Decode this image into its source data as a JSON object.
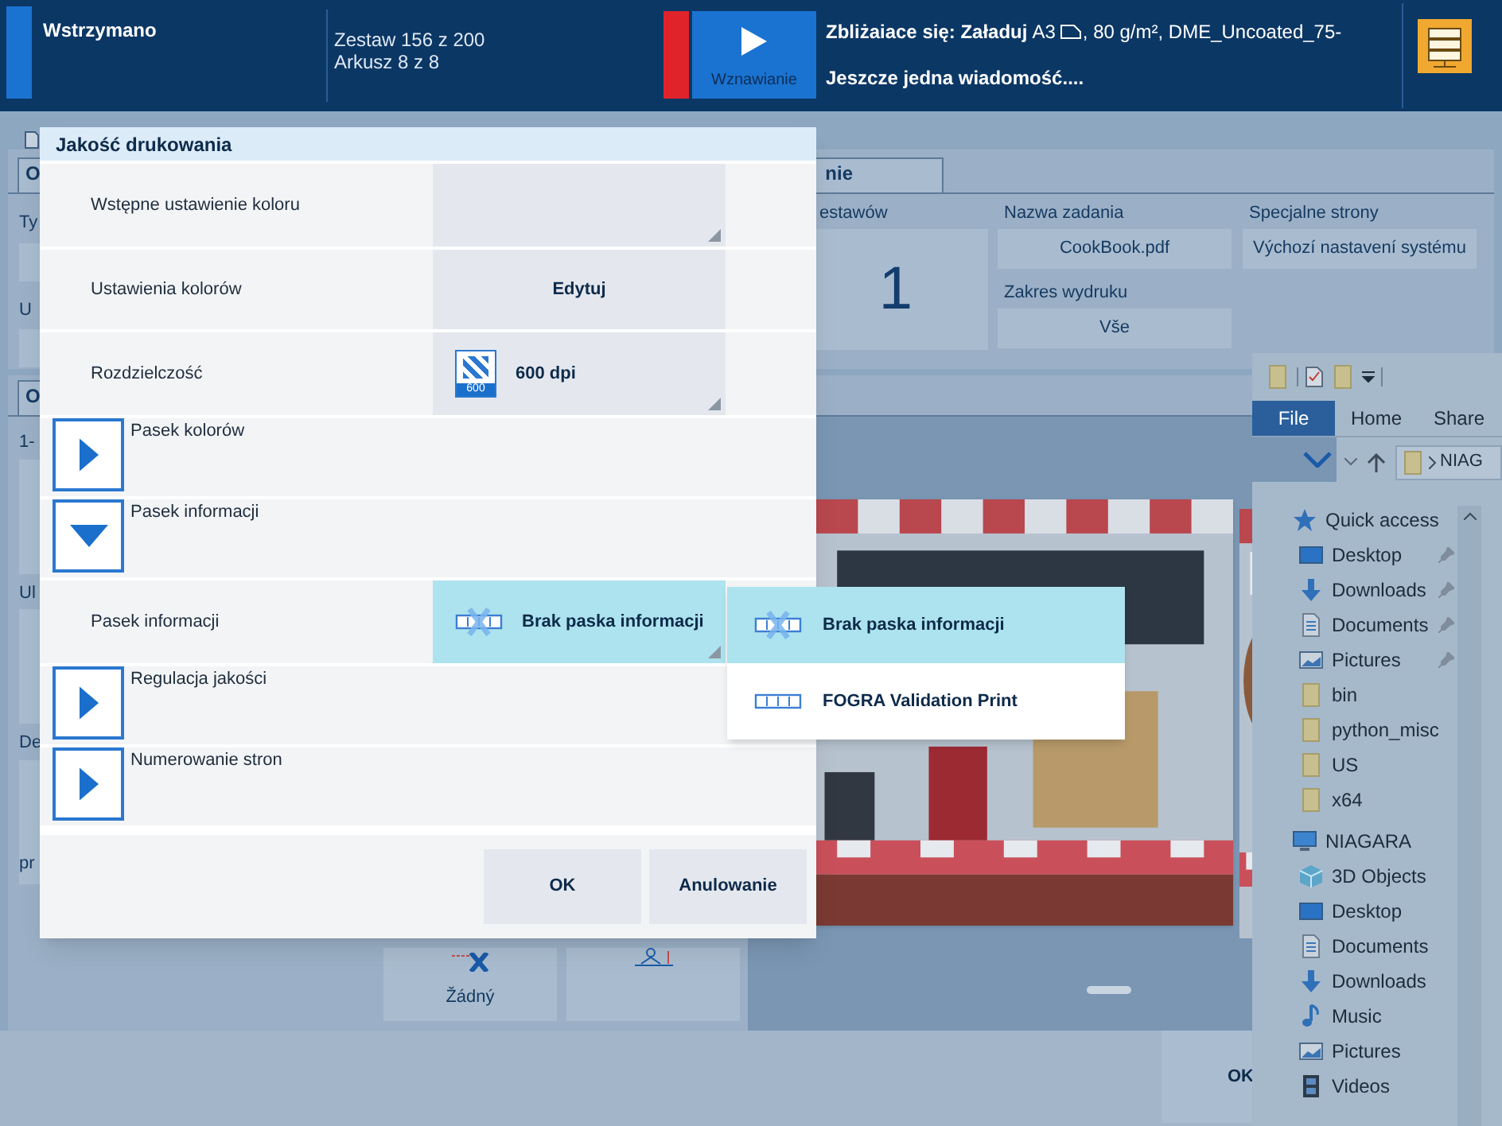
{
  "status_bar": {
    "state": "Wstrzymano",
    "set_progress": "Zestaw 156 z 200",
    "sheet_progress": "Arkusz 8 z 8",
    "resume_button": "Wznawianie",
    "upcoming_label": "Zbliżaiace się: Załaduj",
    "paper_size": "A3",
    "paper_details": ", 80 g/m², DME_Uncoated_75-",
    "message": "Jeszcze jedna wiadomość...."
  },
  "job_panel": {
    "left_tab": "O",
    "left_labels": [
      "Ty",
      "U"
    ],
    "right_tab": "nie",
    "sets_label": "estawów",
    "sets_value": "1",
    "fields": [
      {
        "label": "Nazwa zadania",
        "value": "CookBook.pdf"
      },
      {
        "label": "Zakres wydruku",
        "value": "Vše"
      },
      {
        "label": "Specjalne strony",
        "value": "Výchozí nastavení systému"
      }
    ]
  },
  "preview_panel": {
    "tab": "O",
    "labels": [
      "1-",
      "Ul",
      "De"
    ],
    "box_label": "pr",
    "tile_label": "Žádný"
  },
  "bottom_bar": {
    "ok_button": "OK"
  },
  "dialog": {
    "title": "Jakość drukowania",
    "rows": [
      {
        "kind": "select",
        "label": "Wstępne ustawienie koloru",
        "open": false
      },
      {
        "kind": "button",
        "label": "Ustawienia kolorów",
        "value": "Edytuj"
      },
      {
        "kind": "resolution",
        "label": "Rozdzielczość",
        "value": "600 dpi",
        "icon_text": "600",
        "open": false
      },
      {
        "kind": "expander",
        "label": "Pasek kolorów",
        "expanded": false
      },
      {
        "kind": "expander",
        "label": "Pasek informacji",
        "expanded": true
      },
      {
        "kind": "strip",
        "label": "Pasek informacji",
        "value": "Brak paska informacji",
        "open": true
      },
      {
        "kind": "expander",
        "label": "Regulacja jakości",
        "expanded": false
      },
      {
        "kind": "expander",
        "label": "Numerowanie stron",
        "expanded": false
      }
    ],
    "buttons": [
      "OK",
      "Anulowanie"
    ]
  },
  "dropdown": {
    "options": [
      {
        "label": "Brak paska informacji",
        "kind": "no_strip",
        "selected": true
      },
      {
        "label": "FOGRA Validation Print",
        "kind": "strip",
        "selected": false
      }
    ]
  },
  "explorer": {
    "tabs": [
      {
        "label": "File",
        "selected": true
      },
      {
        "label": "Home",
        "selected": false
      },
      {
        "label": "Share",
        "selected": false
      }
    ],
    "address": "NIAG",
    "tree": [
      {
        "label": "Quick access",
        "kind": "star",
        "children": [
          {
            "label": "Desktop",
            "kind": "desktop",
            "pinned": true
          },
          {
            "label": "Downloads",
            "kind": "download",
            "pinned": true
          },
          {
            "label": "Documents",
            "kind": "document",
            "pinned": true
          },
          {
            "label": "Pictures",
            "kind": "pictures",
            "pinned": true
          },
          {
            "label": "bin",
            "kind": "folder",
            "pinned": false
          },
          {
            "label": "python_misc",
            "kind": "folder",
            "pinned": false
          },
          {
            "label": "US",
            "kind": "folder",
            "pinned": false
          },
          {
            "label": "x64",
            "kind": "folder",
            "pinned": false
          }
        ]
      },
      {
        "label": "NIAGARA",
        "kind": "computer",
        "children": [
          {
            "label": "3D Objects",
            "kind": "cube",
            "pinned": false
          },
          {
            "label": "Desktop",
            "kind": "desktop",
            "pinned": false
          },
          {
            "label": "Documents",
            "kind": "document",
            "pinned": false
          },
          {
            "label": "Downloads",
            "kind": "download",
            "pinned": false
          },
          {
            "label": "Music",
            "kind": "music",
            "pinned": false
          },
          {
            "label": "Pictures",
            "kind": "pictures",
            "pinned": false
          },
          {
            "label": "Videos",
            "kind": "video",
            "pinned": false
          }
        ]
      }
    ]
  }
}
